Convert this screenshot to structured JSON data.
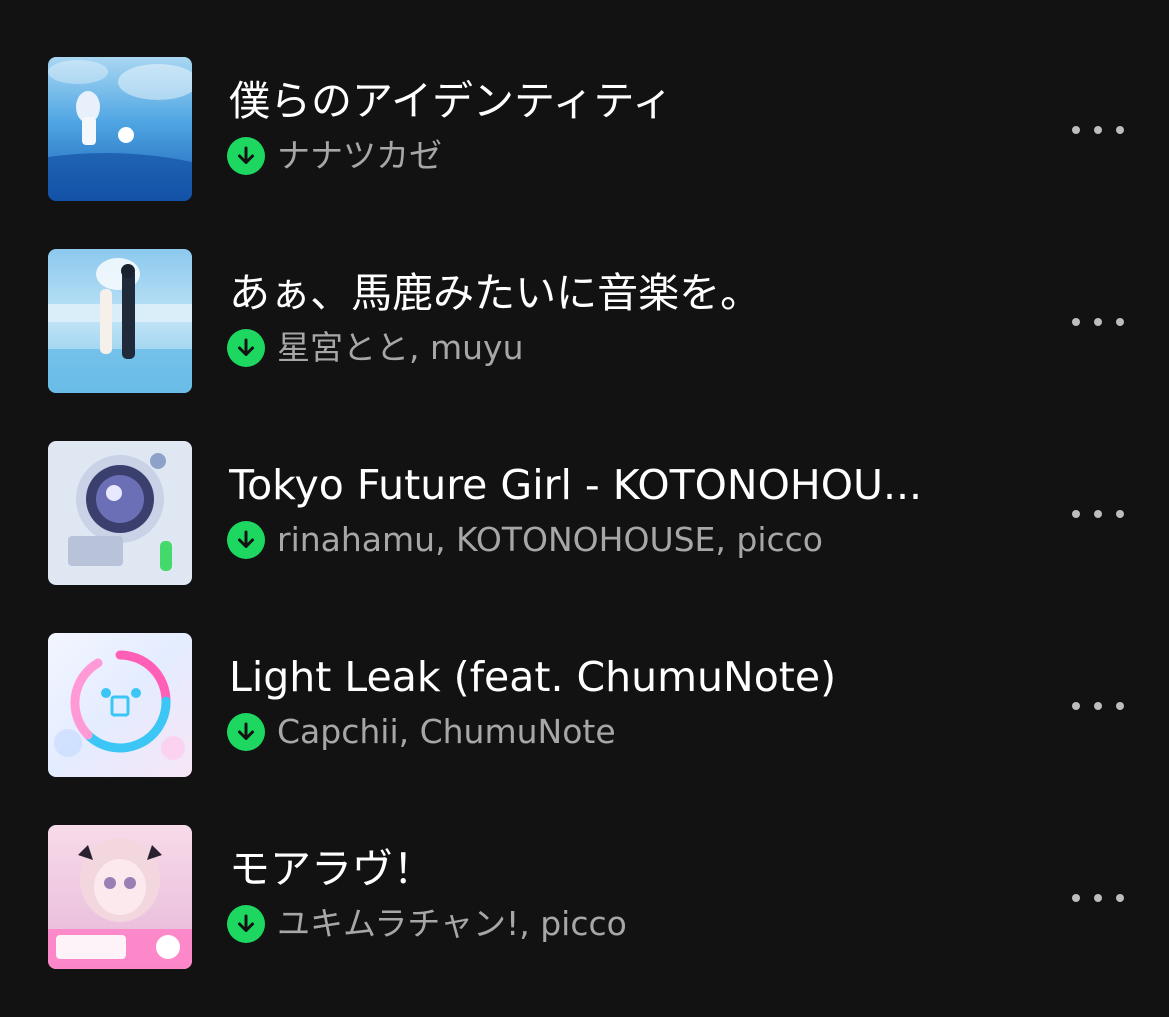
{
  "tracks": [
    {
      "title": "僕らのアイデンティティ",
      "artists": "ナナツカゼ",
      "downloaded": true,
      "cover_icon": "album-art-sky-girl"
    },
    {
      "title": "あぁ、馬鹿みたいに音楽を。",
      "artists": "星宮とと, muyu",
      "downloaded": true,
      "cover_icon": "album-art-pool-couple"
    },
    {
      "title": "Tokyo Future Girl - KOTONOHOU...",
      "artists": "rinahamu, KOTONOHOUSE, picco",
      "downloaded": true,
      "cover_icon": "album-art-capsule"
    },
    {
      "title": "Light Leak (feat. ChumuNote)",
      "artists": "Capchii, ChumuNote",
      "downloaded": true,
      "cover_icon": "album-art-light-leak"
    },
    {
      "title": "モアラヴ！",
      "artists": "ユキムラチャン!, picco",
      "downloaded": true,
      "cover_icon": "album-art-pink-girl"
    }
  ],
  "colors": {
    "background": "#121212",
    "title_text": "#ffffff",
    "artist_text": "#a7a7a7",
    "download_badge": "#1ed760"
  },
  "more_icon": "more-options-icon",
  "download_icon": "download-arrow-icon"
}
